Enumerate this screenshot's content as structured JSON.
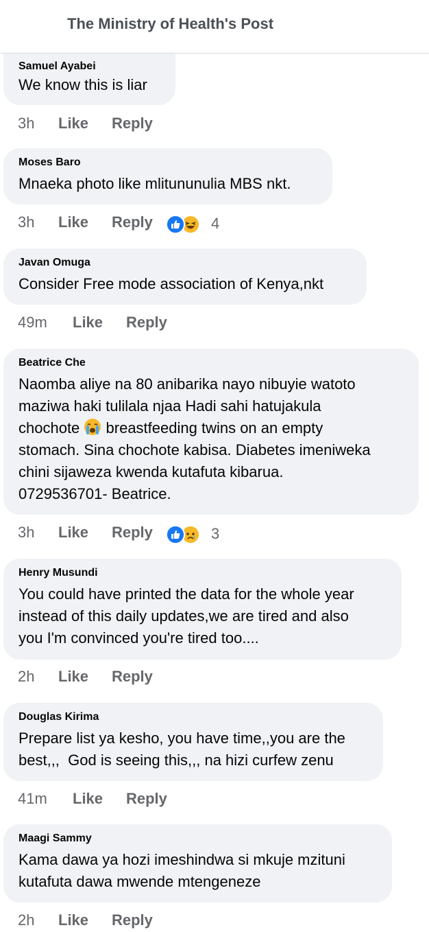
{
  "header": {
    "title": "The Ministry of Health's Post"
  },
  "actions": {
    "like_label": "Like",
    "reply_label": "Reply"
  },
  "colors": {
    "like_blue": "#1877f2",
    "haha_yellow": "#f7b928",
    "bubble_bg": "#f0f2f5",
    "meta_grey": "#65676b"
  },
  "comments": [
    {
      "author": "Samuel Ayabei",
      "text": "We know this is liar",
      "time": "3h",
      "reactions": null
    },
    {
      "author": "Moses Baro",
      "text": "Mnaeka photo like mlitununulia MBS nkt.",
      "time": "3h",
      "reactions": {
        "icons": [
          "like-icon",
          "haha-icon"
        ],
        "count": "4"
      }
    },
    {
      "author": "Javan Omuga",
      "text": "Consider Free mode association of Kenya,nkt",
      "time": "49m",
      "reactions": null
    },
    {
      "author": "Beatrice Che",
      "text_line1": "Naomba aliye na 80 anibarika nayo nibuyie watoto",
      "text_line2": "maziwa haki tulilala njaa Hadi sahi hatujakula",
      "text_line3a": "chochote ",
      "text_line3b": " breastfeeding twins on an empty",
      "text_line4": "stomach. Sina chochote kabisa. Diabetes imeniweka",
      "text_line5": "chini sijaweza kwenda kutafuta kibarua.",
      "text_line6": "0729536701- Beatrice.",
      "emoji": "crying-face-icon",
      "time": "3h",
      "reactions": {
        "icons": [
          "like-icon",
          "sad-icon"
        ],
        "count": "3"
      }
    },
    {
      "author": "Henry Musundi",
      "text": "You could have printed the data for the whole year\ninstead of this daily updates,we are tired and also\nyou I'm convinced you're tired too....",
      "time": "2h",
      "reactions": null
    },
    {
      "author": "Douglas Kirima",
      "text": "Prepare list ya kesho, you have time,,you are the\nbest,,,  God is seeing this,,, na hizi curfew zenu",
      "time": "41m",
      "reactions": null
    },
    {
      "author": "Maagi Sammy",
      "text": "Kama dawa ya hozi imeshindwa si mkuje mzituni\nkutafuta dawa mwende mtengeneze",
      "time": "2h",
      "reactions": null
    }
  ]
}
